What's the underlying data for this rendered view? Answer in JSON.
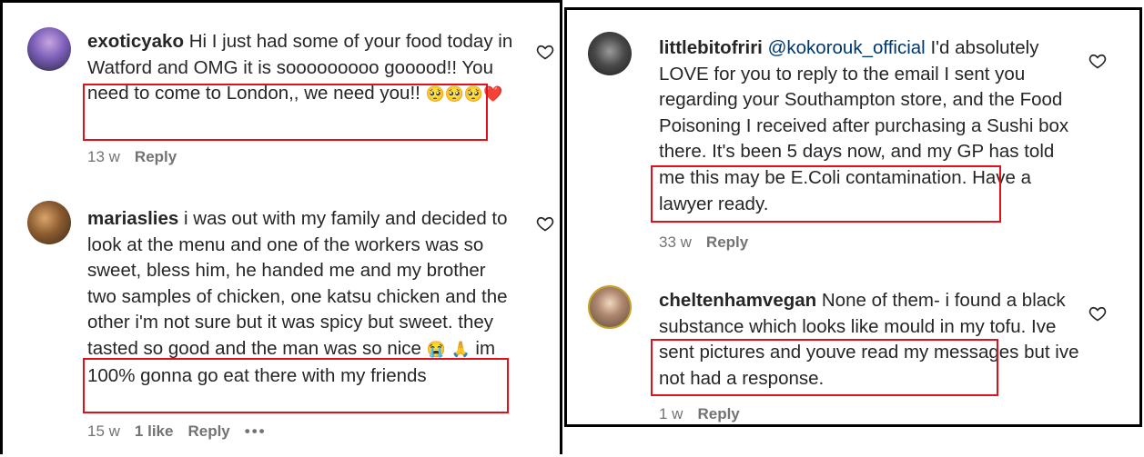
{
  "comments": [
    {
      "username": "exoticyako",
      "text": "Hi I just had some of your food today in Watford and OMG it is sooooooooo gooood!! You need to come to London,, we need you!!",
      "emojis": [
        "🥺",
        "🥺",
        "🥺",
        "❤️"
      ],
      "time": "13 w",
      "reply_label": "Reply",
      "avatar_icon": "user-avatar"
    },
    {
      "username": "mariaslies",
      "text": "i was out with my family and decided to look at the menu and one of the workers was so sweet, bless him, he handed me and my brother two samples of chicken, one katsu chicken and the other i'm not sure but it was spicy but sweet. they tasted so good and the man was so nice",
      "emojis": [
        "😭",
        "🙏"
      ],
      "text_after": "im 100% gonna go eat there with my friends",
      "time": "15 w",
      "likes": "1 like",
      "reply_label": "Reply",
      "more_label": "•••",
      "avatar_icon": "user-avatar"
    },
    {
      "username": "littlebitofriri",
      "mention": "@kokorouk_official",
      "text": "I'd absolutely LOVE for you to reply to the email I sent you regarding your Southampton store, and the Food Poisoning I received after purchasing a Sushi box there. It's been 5 days now, and my GP has told me this may be E.Coli contamination. Have a lawyer ready.",
      "time": "33 w",
      "reply_label": "Reply",
      "avatar_icon": "user-avatar"
    },
    {
      "username": "cheltenhamvegan",
      "text": "None of them- i found a black substance which looks like mould in my tofu. Ive sent pictures and youve read my messages but ive not had a response.",
      "time": "1 w",
      "reply_label": "Reply",
      "avatar_icon": "user-avatar"
    }
  ],
  "colors": {
    "highlight": "#e0111b",
    "mention": "#00376b",
    "meta": "#737373"
  },
  "icons": {
    "like": "heart-outline-icon"
  }
}
